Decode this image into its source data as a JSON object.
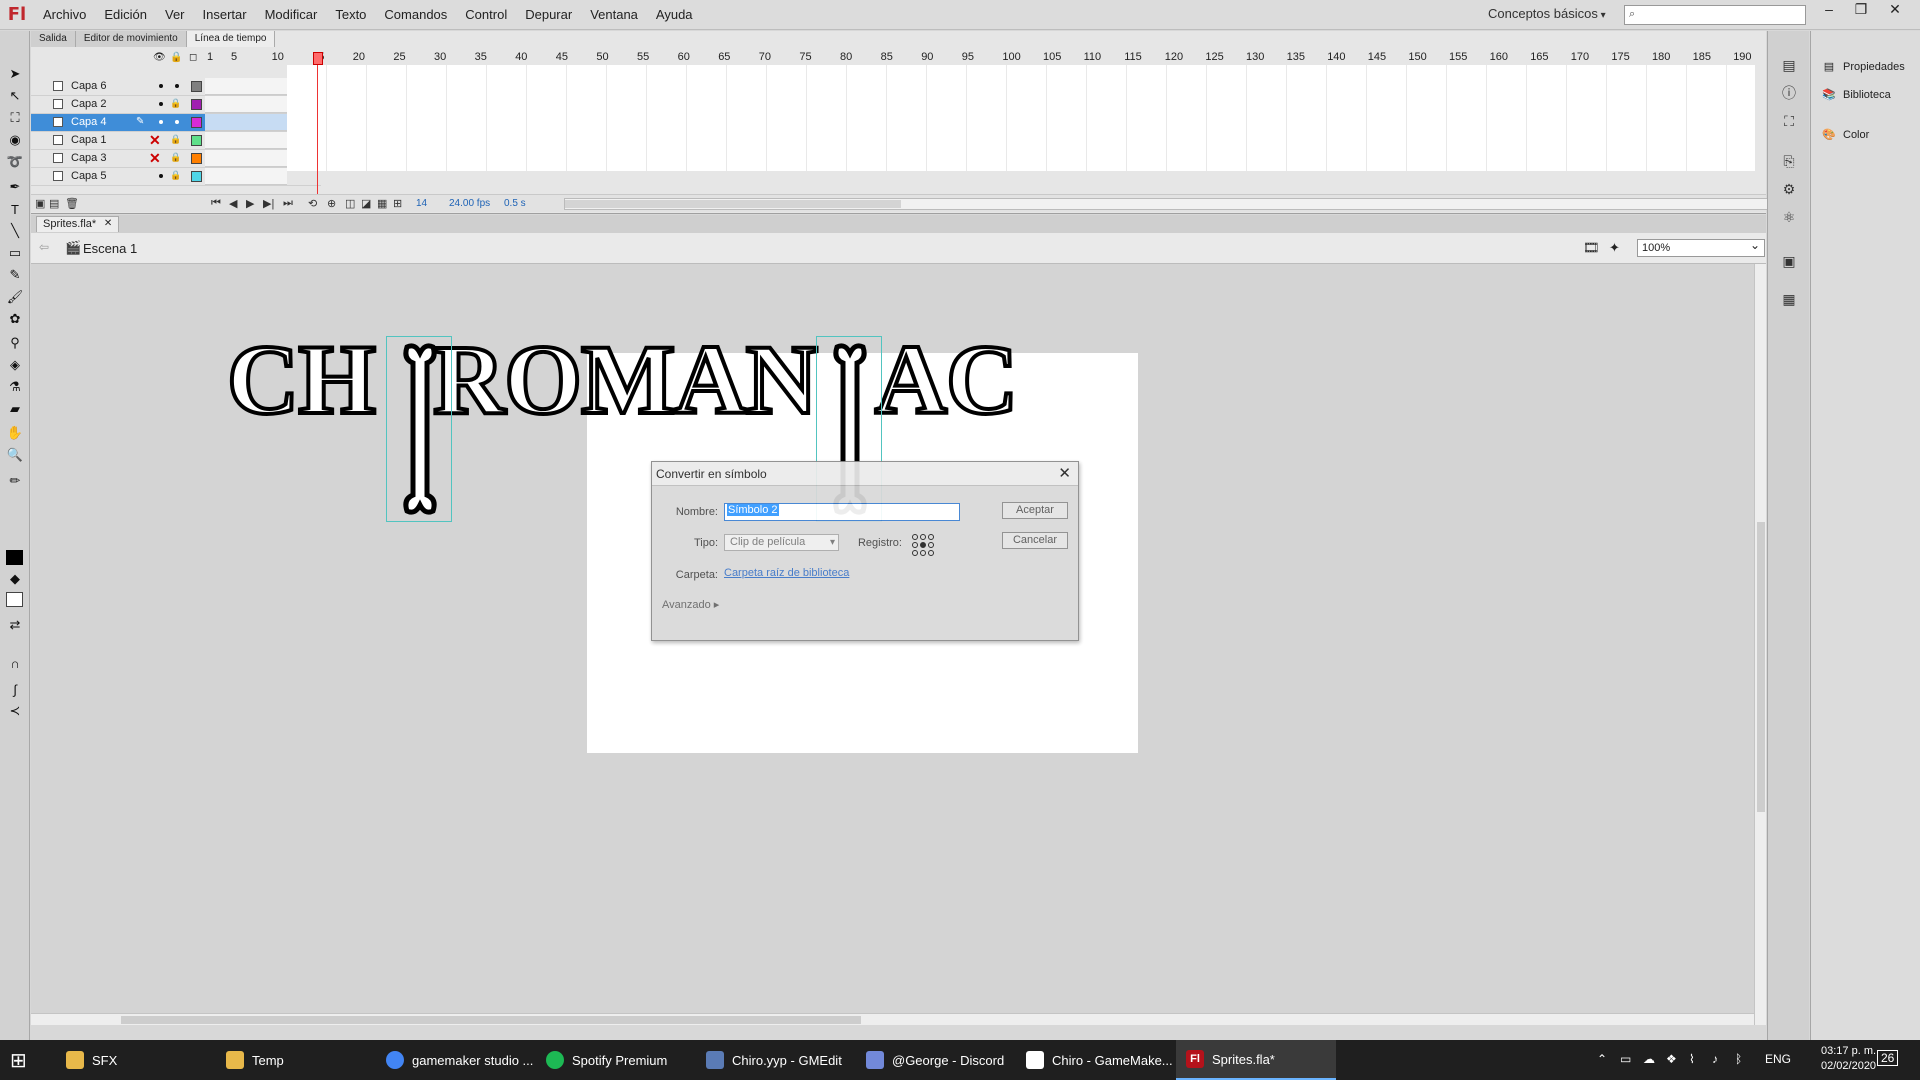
{
  "app": {
    "logo": "Fl"
  },
  "menu": [
    "Archivo",
    "Edición",
    "Ver",
    "Insertar",
    "Modificar",
    "Texto",
    "Comandos",
    "Control",
    "Depurar",
    "Ventana",
    "Ayuda"
  ],
  "workspace": "Conceptos básicos",
  "search": {
    "placeholder": ""
  },
  "window_controls": {
    "minimize": "–",
    "restore": "❐",
    "close": "✕"
  },
  "timeline_tabs": [
    "Salida",
    "Editor de movimiento",
    "Línea de tiempo"
  ],
  "layers": [
    {
      "name": "Capa 6",
      "color": "#7f7f7f",
      "hidden": false
    },
    {
      "name": "Capa 2",
      "color": "#a020b0",
      "hidden": false
    },
    {
      "name": "Capa 4",
      "color": "#d62ad6",
      "hidden": false,
      "selected": true
    },
    {
      "name": "Capa 1",
      "color": "#5fe08a",
      "hidden": true
    },
    {
      "name": "Capa 3",
      "color": "#ff7f00",
      "hidden": true
    },
    {
      "name": "Capa 5",
      "color": "#4fd6e8",
      "hidden": false
    }
  ],
  "frame_ruler": [
    "1",
    "5",
    "10",
    "15",
    "20",
    "25",
    "30",
    "35",
    "40",
    "45",
    "50",
    "55",
    "60",
    "65",
    "70",
    "75",
    "80",
    "85",
    "90",
    "95",
    "100",
    "105",
    "110",
    "115",
    "120",
    "125",
    "130",
    "135",
    "140",
    "145",
    "150",
    "155",
    "160",
    "165",
    "170",
    "175",
    "180",
    "185",
    "190"
  ],
  "timeline_status": {
    "frame": "14",
    "fps": "24.00 fps",
    "time": "0.5 s"
  },
  "document": {
    "tab": "Sprites.fla*",
    "scene": "Escena 1",
    "zoom": "100%"
  },
  "stage": {
    "title_art": [
      "CH",
      "ROMAN",
      "AC"
    ]
  },
  "dialog": {
    "title": "Convertir en símbolo",
    "name_label": "Nombre:",
    "name_value": "Símbolo 2",
    "type_label": "Tipo:",
    "type_value": "Clip de película",
    "registration_label": "Registro:",
    "folder_label": "Carpeta:",
    "folder_value": "Carpeta raíz de biblioteca",
    "advanced": "Avanzado",
    "ok": "Aceptar",
    "cancel": "Cancelar"
  },
  "right_panel": {
    "properties": "Propiedades",
    "library": "Biblioteca",
    "color": "Color"
  },
  "taskbar": [
    {
      "label": "SFX",
      "icon": "folder-icon"
    },
    {
      "label": "Temp",
      "icon": "folder-icon"
    },
    {
      "label": "gamemaker studio ...",
      "icon": "chrome-icon"
    },
    {
      "label": "Spotify Premium",
      "icon": "spotify-icon"
    },
    {
      "label": "Chiro.yyp - GMEdit",
      "icon": "gmedit-icon"
    },
    {
      "label": "@George - Discord",
      "icon": "discord-icon"
    },
    {
      "label": "Chiro - GameMake...",
      "icon": "gamemaker-icon"
    },
    {
      "label": "Sprites.fla*",
      "icon": "flash-icon",
      "active": true
    }
  ],
  "tray": {
    "lang": "ENG",
    "time": "03:17 p. m.",
    "date": "02/02/2020",
    "notifications": "26"
  }
}
